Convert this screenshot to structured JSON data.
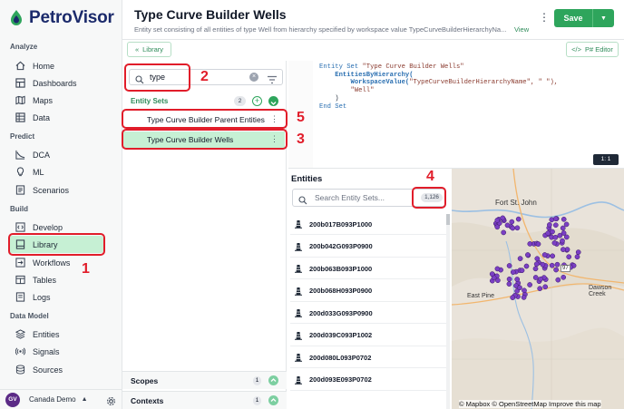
{
  "app": {
    "name": "PetroVisor"
  },
  "sidebar": {
    "sections": [
      {
        "label": "Analyze",
        "items": [
          {
            "label": "Home",
            "icon": "home-icon"
          },
          {
            "label": "Dashboards",
            "icon": "dashboard-icon"
          },
          {
            "label": "Maps",
            "icon": "map-icon"
          },
          {
            "label": "Data",
            "icon": "table-icon"
          }
        ]
      },
      {
        "label": "Predict",
        "items": [
          {
            "label": "DCA",
            "icon": "chart-icon"
          },
          {
            "label": "ML",
            "icon": "bulb-icon"
          },
          {
            "label": "Scenarios",
            "icon": "scenario-icon"
          }
        ]
      },
      {
        "label": "Build",
        "items": [
          {
            "label": "Develop",
            "icon": "code-icon"
          },
          {
            "label": "Library",
            "icon": "library-icon",
            "active": true
          },
          {
            "label": "Workflows",
            "icon": "workflow-icon"
          },
          {
            "label": "Tables",
            "icon": "tables-icon"
          },
          {
            "label": "Logs",
            "icon": "logs-icon"
          }
        ]
      },
      {
        "label": "Data Model",
        "items": [
          {
            "label": "Entities",
            "icon": "entities-icon"
          },
          {
            "label": "Signals",
            "icon": "signals-icon"
          },
          {
            "label": "Sources",
            "icon": "sources-icon"
          }
        ]
      }
    ],
    "footer": {
      "avatar": "GV",
      "workspace": "Canada Demo"
    }
  },
  "header": {
    "title": "Type Curve Builder Wells",
    "subtitle": "Entity set consisting of all entities of type Well from hierarchy specified by workspace value TypeCurveBuilderHierarchyNa...",
    "view_link": "View",
    "save_label": "Save",
    "library_btn": "Library",
    "editor_btn": "P# Editor"
  },
  "left_panel": {
    "search_value": "type",
    "entity_sets_label": "Entity Sets",
    "entity_sets_count": "2",
    "entity_sets": [
      {
        "label": "Type Curve Builder Parent Entities"
      },
      {
        "label": "Type Curve Builder Wells",
        "selected": true
      }
    ],
    "scopes_label": "Scopes",
    "scopes_count": "1",
    "contexts_label": "Contexts",
    "contexts_count": "1"
  },
  "code": {
    "line1_kw": "Entity Set",
    "line1_str": "\"Type Curve Builder Wells\"",
    "line2_fn": "EntitiesByHierarchy(",
    "line3_fn": "WorkspaceValue(",
    "line3_str": "\"TypeCurveBuilderHierarchyName\", \" \"),",
    "line4_str": "\"Well\"",
    "line5": ")",
    "line6_kw": "End Set",
    "position": "1: 1"
  },
  "entities": {
    "title": "Entities",
    "search_placeholder": "Search Entity Sets...",
    "count": "1,126",
    "rows": [
      "200b017B093P1000",
      "200b042G093P0900",
      "200b063B093P1000",
      "200b068H093P0900",
      "200d033G093P0900",
      "200d039C093P1002",
      "200d080L093P0702",
      "200d093E093P0702"
    ]
  },
  "map": {
    "labels": {
      "fort_st_john": "Fort St. John",
      "east_pine": "East Pine",
      "dawson_creek": "Dawson Creek",
      "hwy_97": "97"
    },
    "attribution": "© Mapbox © OpenStreetMap Improve this map",
    "point_color": "#7b3fc4"
  },
  "annotations": {
    "n1": "1",
    "n2": "2",
    "n3": "3",
    "n4": "4",
    "n5": "5",
    "color": "#e11d2a"
  }
}
